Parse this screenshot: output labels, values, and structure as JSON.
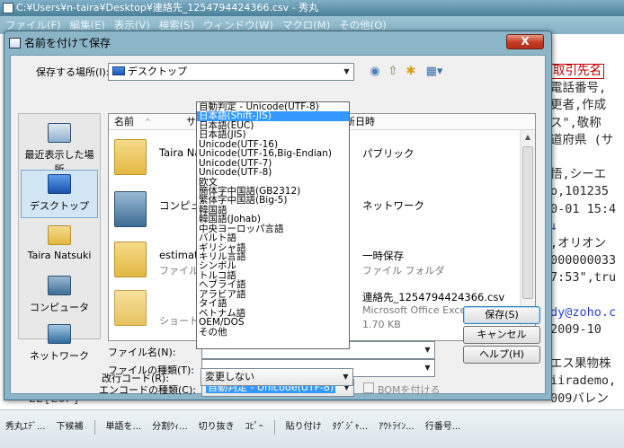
{
  "app": {
    "title": "C:¥Users¥n-taira¥Desktop¥連絡先_1254794424366.csv  - 秀丸",
    "menu": [
      "ファイル(F)",
      "編集(E)",
      "表示(V)",
      "検索(S)",
      "ウィンドウ(W)",
      "マクロ(M)",
      "その他(O)"
    ]
  },
  "editor": {
    "right_lines": [
      {
        "text": "取引先名",
        "style": "red"
      },
      {
        "text": "電話番号,",
        "style": ""
      },
      {
        "text": "更者,作成",
        "style": ""
      },
      {
        "text": "ス\",敬称",
        "style": ""
      },
      {
        "text": "道府県 (サ",
        "style": ""
      },
      {
        "text": "",
        "style": ""
      },
      {
        "text": "悟,シーエ",
        "style": ""
      },
      {
        "text": "o,101235",
        "style": ""
      },
      {
        "text": "0-01 15:4",
        "style": ""
      },
      {
        "text": "↓",
        "style": "blue"
      },
      {
        "text": ",オリオン",
        "style": ""
      },
      {
        "text": "000000033",
        "style": ""
      },
      {
        "text": "7:53\",tru",
        "style": ""
      },
      {
        "text": "",
        "style": ""
      },
      {
        "text": "dy@zoho.c",
        "style": "blue"
      },
      {
        "text": " 2009-10",
        "style": ""
      },
      {
        "text": "",
        "style": ""
      },
      {
        "text": "エス果物株",
        "style": ""
      },
      {
        "text": "iirademo,",
        "style": ""
      },
      {
        "text": "009バレン",
        "style": ""
      }
    ],
    "eof": "22[EOF]"
  },
  "statusbar": {
    "items": [
      "秀丸ｴﾃﾞ...",
      "下候補",
      "|",
      "単語を...",
      "分割ｳｨ...",
      "切り抜き",
      "ｺﾋﾟｰ",
      "|",
      "貼り付け",
      "ﾀｸﾞｼﾞｬ...",
      "ｱｳﾄﾗｲﾝ...",
      "行番号..."
    ]
  },
  "dialog": {
    "title": "名前を付けて保存",
    "close_label": "X",
    "save_in_label": "保存する場所(I):",
    "save_in_value": "デスクトップ",
    "places": [
      {
        "label": "最近表示した場所",
        "icon": "recent-places-icon"
      },
      {
        "label": "デスクトップ",
        "icon": "desktop-icon"
      },
      {
        "label": "Taira Natsuki",
        "icon": "user-folder-icon"
      },
      {
        "label": "コンピュータ",
        "icon": "computer-icon"
      },
      {
        "label": "ネットワーク",
        "icon": "network-icon"
      }
    ],
    "columns": [
      "名前",
      "サイズ",
      "種類",
      "更新日時"
    ],
    "files": [
      {
        "name": "Taira Nats",
        "sub": "",
        "icon": "user-folder-icon",
        "right": "パブリック",
        "right_sub": ""
      },
      {
        "name": "コンピュー",
        "sub": "",
        "icon": "computer-icon",
        "right": "ネットワーク",
        "right_sub": ""
      },
      {
        "name": "estimate_",
        "sub": "ファイル フ",
        "icon": "folder-icon",
        "right": "一時保存",
        "right_sub": "ファイル フォルダ"
      },
      {
        "name": "",
        "sub": "ショートカ",
        "icon": "shortcut-folder-icon",
        "right": "連絡先_1254794424366.csv",
        "right_sub": "Microsoft Office Excel CSV ...",
        "right_sub2": "1.70 KB"
      }
    ],
    "filename_label": "ファイル名(N):",
    "filetype_label": "ファイルの種類(T):",
    "encoding_label": "エンコードの種類(C):",
    "encoding_value": "自動判定 - Unicode(UTF-8)",
    "bom_label": "BOMを付ける",
    "newline_label": "改行コード(R):",
    "newline_value": "変更しない",
    "buttons": {
      "save": "保存(S)",
      "cancel": "キャンセル",
      "help": "ヘルプ(H)"
    },
    "encoding_options": [
      "自動判定 - Unicode(UTF-8)",
      "日本語(Shift-JIS)",
      "日本語(EUC)",
      "日本語(JIS)",
      "Unicode(UTF-16)",
      "Unicode(UTF-16,Big-Endian)",
      "Unicode(UTF-7)",
      "Unicode(UTF-8)",
      "欧文",
      "簡体字中国語(GB2312)",
      "繁体字中国語(Big-5)",
      "韓国語",
      "韓国語(Johab)",
      "中央ヨーロッパ言語",
      "バルト語",
      "ギリシャ語",
      "キリル言語",
      "シンボル",
      "トルコ語",
      "ヘブライ語",
      "アラビア語",
      "タイ語",
      "ベトナム語",
      "OEM/DOS",
      "その他"
    ],
    "highlighted_option": "日本語(Shift-JIS)"
  }
}
